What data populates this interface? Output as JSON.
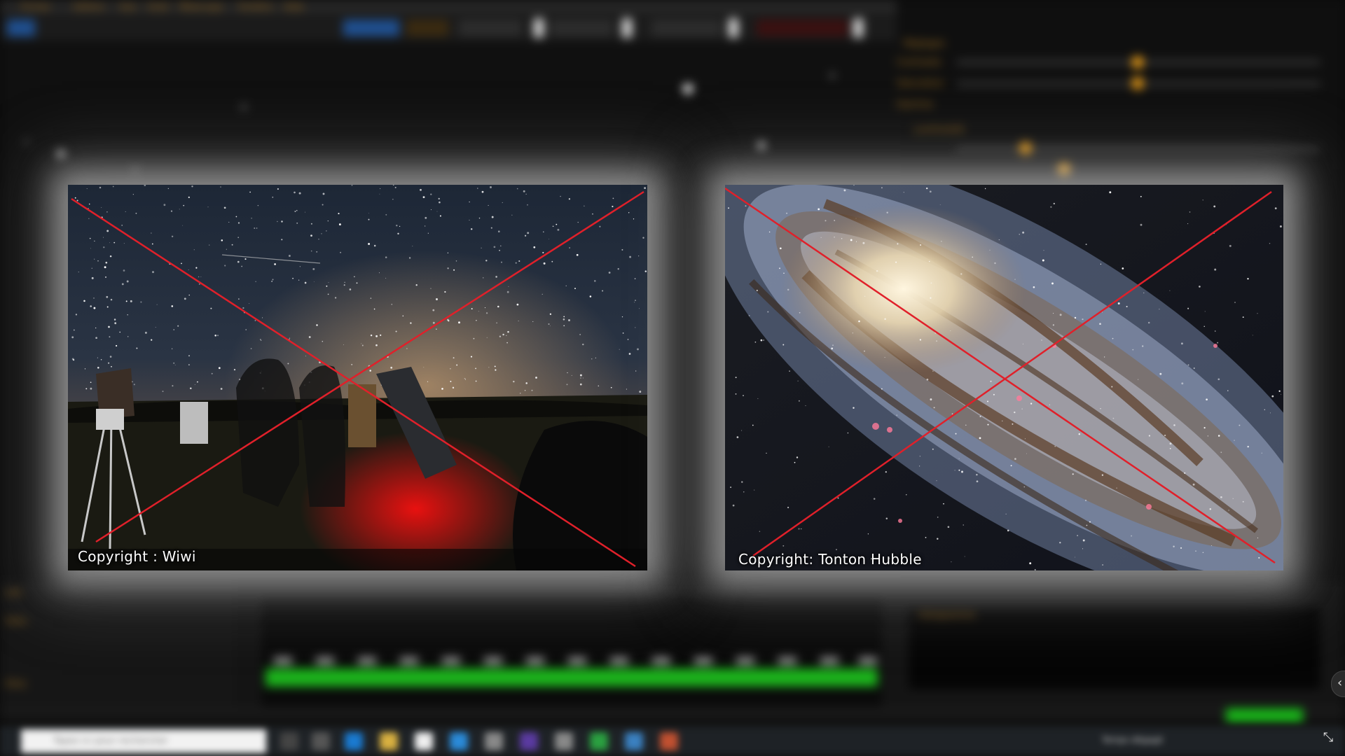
{
  "background_app": {
    "menu": [
      "Fichier",
      "Edition",
      "Vue",
      "Outil",
      "Télescope",
      "Fenêtre",
      "Aide"
    ],
    "right_panel_labels": [
      "Réglages",
      "Contraste",
      "Saturation",
      "Gamma",
      "Luminosité"
    ],
    "status_labels": [
      "Info",
      "Stats",
      "Filtre",
      "Histogramme"
    ]
  },
  "photos": {
    "left": {
      "caption": "Copyright : Wiwi",
      "cross_color": "#e0202a"
    },
    "right": {
      "caption": "Copyright: Tonton Hubble",
      "cross_color": "#e0202a"
    }
  },
  "taskbar": {
    "search_placeholder": "Tapez ici pour rechercher",
    "tray_text": "Temps dégagé"
  },
  "colors": {
    "accent_orange": "#e69a16",
    "histogram_green": "#1cb31c"
  }
}
